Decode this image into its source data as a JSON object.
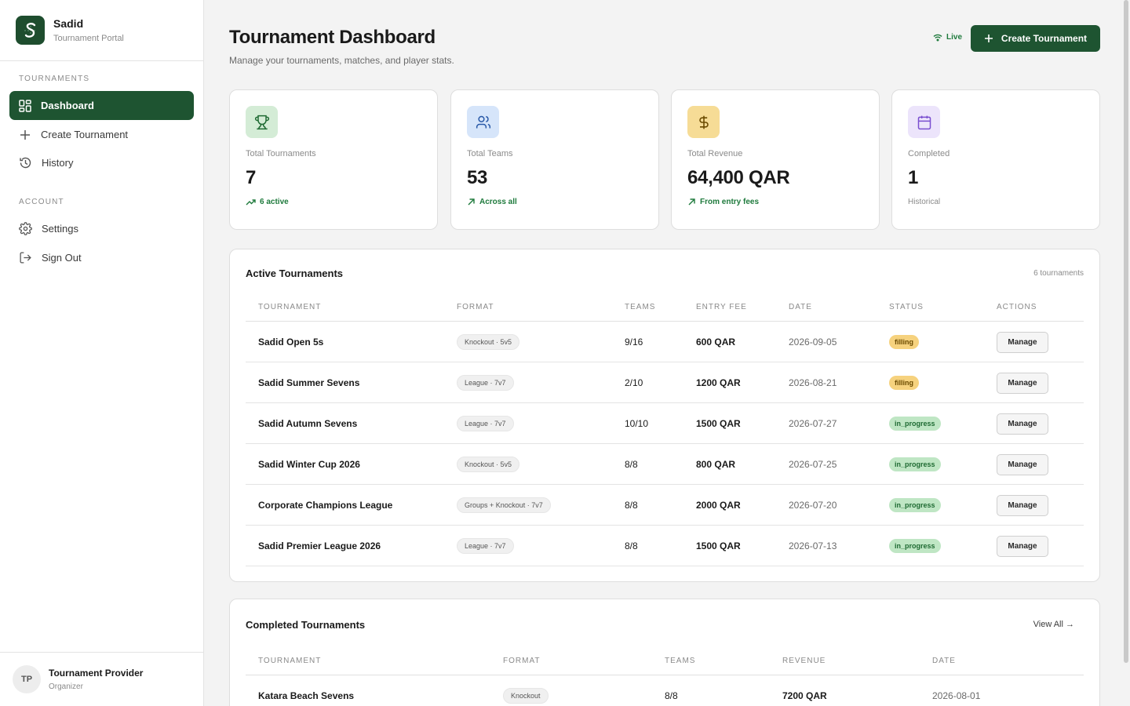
{
  "brand": {
    "name": "Sadid",
    "subtitle": "Tournament Portal"
  },
  "sidebar": {
    "section_tournaments": "TOURNAMENTS",
    "section_account": "ACCOUNT",
    "items": [
      {
        "label": "Dashboard",
        "icon": "dashboard-icon",
        "active": true
      },
      {
        "label": "Create Tournament",
        "icon": "plus-icon"
      },
      {
        "label": "History",
        "icon": "history-icon"
      },
      {
        "label": "Settings",
        "icon": "gear-icon"
      },
      {
        "label": "Sign Out",
        "icon": "sign-out-icon"
      }
    ]
  },
  "user": {
    "initials": "TP",
    "name": "Tournament Provider",
    "role": "Organizer"
  },
  "header": {
    "title": "Tournament Dashboard",
    "subtitle": "Manage your tournaments, matches, and player stats.",
    "live_label": "Live",
    "create_label": "Create Tournament"
  },
  "stats": [
    {
      "label": "Total Tournaments",
      "value": "7",
      "note": "6 active",
      "icon": "trophy-icon",
      "color": "#d4ecd6"
    },
    {
      "label": "Total Teams",
      "value": "53",
      "note": "Across all",
      "icon": "users-icon",
      "color": "#d6e5fa"
    },
    {
      "label": "Total Revenue",
      "value": "64,400 QAR",
      "note": "From entry fees",
      "icon": "dollar-icon",
      "color": "#f6dc96"
    },
    {
      "label": "Completed",
      "value": "1",
      "note": "Historical",
      "icon": "calendar-icon",
      "color": "#ece4fb"
    }
  ],
  "active": {
    "title": "Active Tournaments",
    "count": "6 tournaments",
    "columns": [
      "TOURNAMENT",
      "FORMAT",
      "TEAMS",
      "ENTRY FEE",
      "DATE",
      "STATUS",
      "ACTIONS"
    ],
    "action_label": "Manage",
    "rows": [
      {
        "name": "Sadid Open 5s",
        "format": "Knockout · 5v5",
        "teams": "9/16",
        "fee": "600 QAR",
        "date": "2026-09-05",
        "status": "filling"
      },
      {
        "name": "Sadid Summer Sevens",
        "format": "League · 7v7",
        "teams": "2/10",
        "fee": "1200 QAR",
        "date": "2026-08-21",
        "status": "filling"
      },
      {
        "name": "Sadid Autumn Sevens",
        "format": "League · 7v7",
        "teams": "10/10",
        "fee": "1500 QAR",
        "date": "2026-07-27",
        "status": "in_progress"
      },
      {
        "name": "Sadid Winter Cup 2026",
        "format": "Knockout · 5v5",
        "teams": "8/8",
        "fee": "800 QAR",
        "date": "2026-07-25",
        "status": "in_progress"
      },
      {
        "name": "Corporate Champions League",
        "format": "Groups + Knockout · 7v7",
        "teams": "8/8",
        "fee": "2000 QAR",
        "date": "2026-07-20",
        "status": "in_progress"
      },
      {
        "name": "Sadid Premier League 2026",
        "format": "League · 7v7",
        "teams": "8/8",
        "fee": "1500 QAR",
        "date": "2026-07-13",
        "status": "in_progress"
      }
    ]
  },
  "completed": {
    "title": "Completed Tournaments",
    "view_all": "View All →",
    "columns": [
      "TOURNAMENT",
      "FORMAT",
      "TEAMS",
      "REVENUE",
      "DATE"
    ],
    "rows": [
      {
        "name": "Katara Beach Sevens",
        "format": "Knockout",
        "teams": "8/8",
        "revenue": "7200 QAR",
        "date": "2026-08-01"
      }
    ]
  },
  "colors": {
    "brand_green": "#1e5431",
    "accent_green": "#1e7a3c",
    "filling": "#f6d27e",
    "in_progress": "#bfe6c4"
  }
}
